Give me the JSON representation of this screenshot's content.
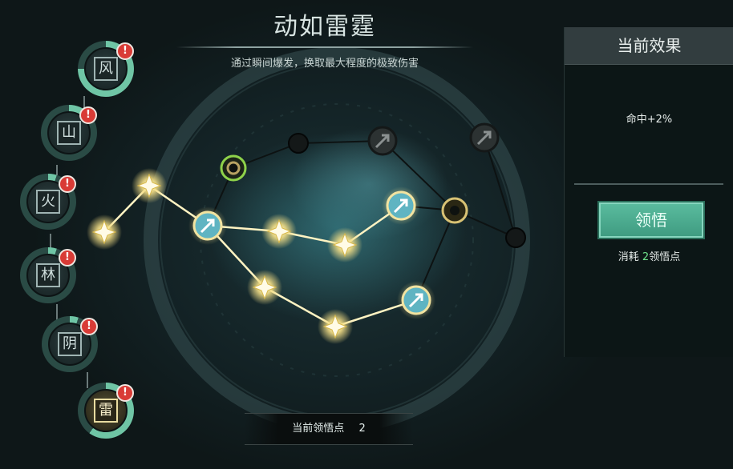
{
  "header": {
    "title": "动如雷霆",
    "subtitle": "通过瞬间爆发，换取最大程度的极致伤害"
  },
  "right_panel": {
    "header": "当前效果",
    "effect": "命中+2%",
    "button_label": "领悟",
    "cost_prefix": "消耗 ",
    "cost_value": "2",
    "cost_suffix": "领悟点"
  },
  "points_bar": {
    "label": "当前领悟点",
    "value": "2"
  },
  "chapters": [
    {
      "id": "feng",
      "glyph": "风",
      "progress": 0.75,
      "alert": "!"
    },
    {
      "id": "shan",
      "glyph": "山",
      "progress": 0.1,
      "alert": "!"
    },
    {
      "id": "huo",
      "glyph": "火",
      "progress": 0.05,
      "alert": "!"
    },
    {
      "id": "lin",
      "glyph": "林",
      "progress": 0.05,
      "alert": "!"
    },
    {
      "id": "yin",
      "glyph": "阴",
      "progress": 0.05,
      "alert": "!"
    },
    {
      "id": "lei",
      "glyph": "雷",
      "progress": 0.6,
      "alert": "!",
      "active": true
    }
  ],
  "colors": {
    "lit_node": "#f6e9a8",
    "skill_node": "#5fb4c2",
    "dark_node": "#141818",
    "accent_green": "#5bbd9f"
  },
  "icons": [
    "arrow-skill-icon",
    "sparkle-icon",
    "alert-icon"
  ]
}
